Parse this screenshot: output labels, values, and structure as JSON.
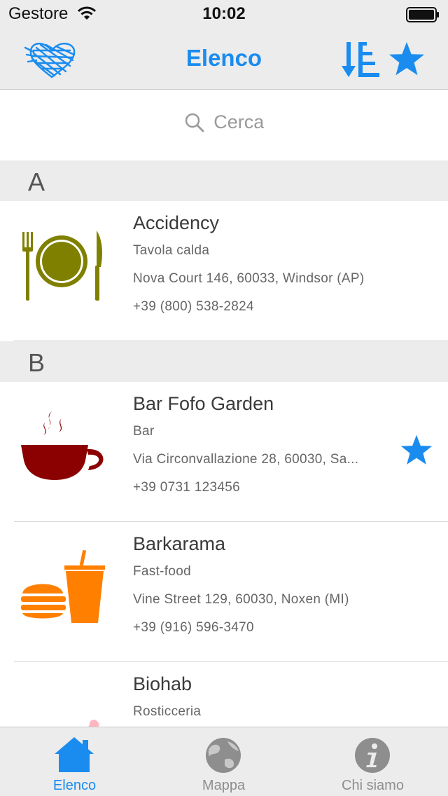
{
  "status_bar": {
    "carrier": "Gestore",
    "time": "10:02"
  },
  "nav": {
    "title": "Elenco",
    "accent_color": "#1a8cf0"
  },
  "search": {
    "placeholder": "Cerca"
  },
  "sections": [
    {
      "letter": "A",
      "items": [
        {
          "name": "Accidency",
          "category": "Tavola calda",
          "address": "Nova Court 146, 60033, Windsor (AP)",
          "phone": "+39 (800) 538-2824",
          "icon": "plate-cutlery-icon",
          "icon_color": "#808000",
          "favorite": false
        }
      ]
    },
    {
      "letter": "B",
      "items": [
        {
          "name": "Bar Fofo Garden",
          "category": "Bar",
          "address": "Via Circonvallazione 28, 60030, Sa...",
          "phone": "+39 0731 123456",
          "icon": "coffee-cup-icon",
          "icon_color": "#8b0000",
          "favorite": true
        },
        {
          "name": "Barkarama",
          "category": "Fast-food",
          "address": "Vine Street 129, 60030, Noxen (MI)",
          "phone": "+39 (916) 596-3470",
          "icon": "burger-drink-icon",
          "icon_color": "#ff8000",
          "favorite": false
        },
        {
          "name": "Biohab",
          "category": "Rosticceria",
          "address": "",
          "phone": "",
          "icon": "roast-meat-icon",
          "icon_color": "#ffb6c1",
          "favorite": false
        }
      ]
    }
  ],
  "tabs": [
    {
      "label": "Elenco",
      "icon": "home-icon",
      "active": true
    },
    {
      "label": "Mappa",
      "icon": "globe-icon",
      "active": false
    },
    {
      "label": "Chi siamo",
      "icon": "info-icon",
      "active": false
    }
  ]
}
